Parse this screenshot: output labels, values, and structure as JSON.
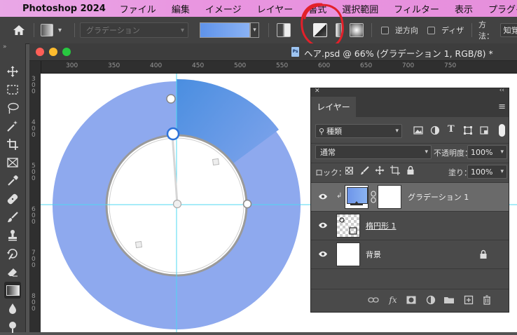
{
  "menubar": {
    "app_name": "Photoshop 2024",
    "items": [
      "ファイル",
      "編集",
      "イメージ",
      "レイヤー",
      "書式",
      "選択範囲",
      "フィルター",
      "表示",
      "プラグイン"
    ]
  },
  "options": {
    "gradient_name": "グラデーション",
    "reverse_label": "逆方向",
    "dither_label": "ディザ",
    "method_label": "方法：",
    "method_value": "知覚"
  },
  "document": {
    "title": "ヘア.psd @ 66% (グラデーション 1, RGB/8) *",
    "ruler_top": [
      "300",
      "350",
      "400",
      "450",
      "500",
      "550",
      "600",
      "650",
      "700",
      "750"
    ],
    "ruler_left": [
      "300",
      "400",
      "500",
      "600",
      "700",
      "800"
    ]
  },
  "layers_panel": {
    "tab_label": "レイヤー",
    "filter_value": "種類",
    "blend_mode": "通常",
    "opacity_label": "不透明度：",
    "opacity_value": "100%",
    "lock_label": "ロック：",
    "fill_label": "塗り：",
    "fill_value": "100%",
    "layers": [
      {
        "name": "グラデーション 1",
        "selected": true
      },
      {
        "name": "楕円形 1",
        "selected": false
      },
      {
        "name": "背景",
        "selected": false
      }
    ]
  },
  "colors": {
    "menubar_bg": "#e995e0",
    "gradient_light": "#8ea9ee",
    "gradient_dark": "#4a8ee0",
    "guide": "#4fd8f2",
    "annotation_red": "#e3202a"
  }
}
